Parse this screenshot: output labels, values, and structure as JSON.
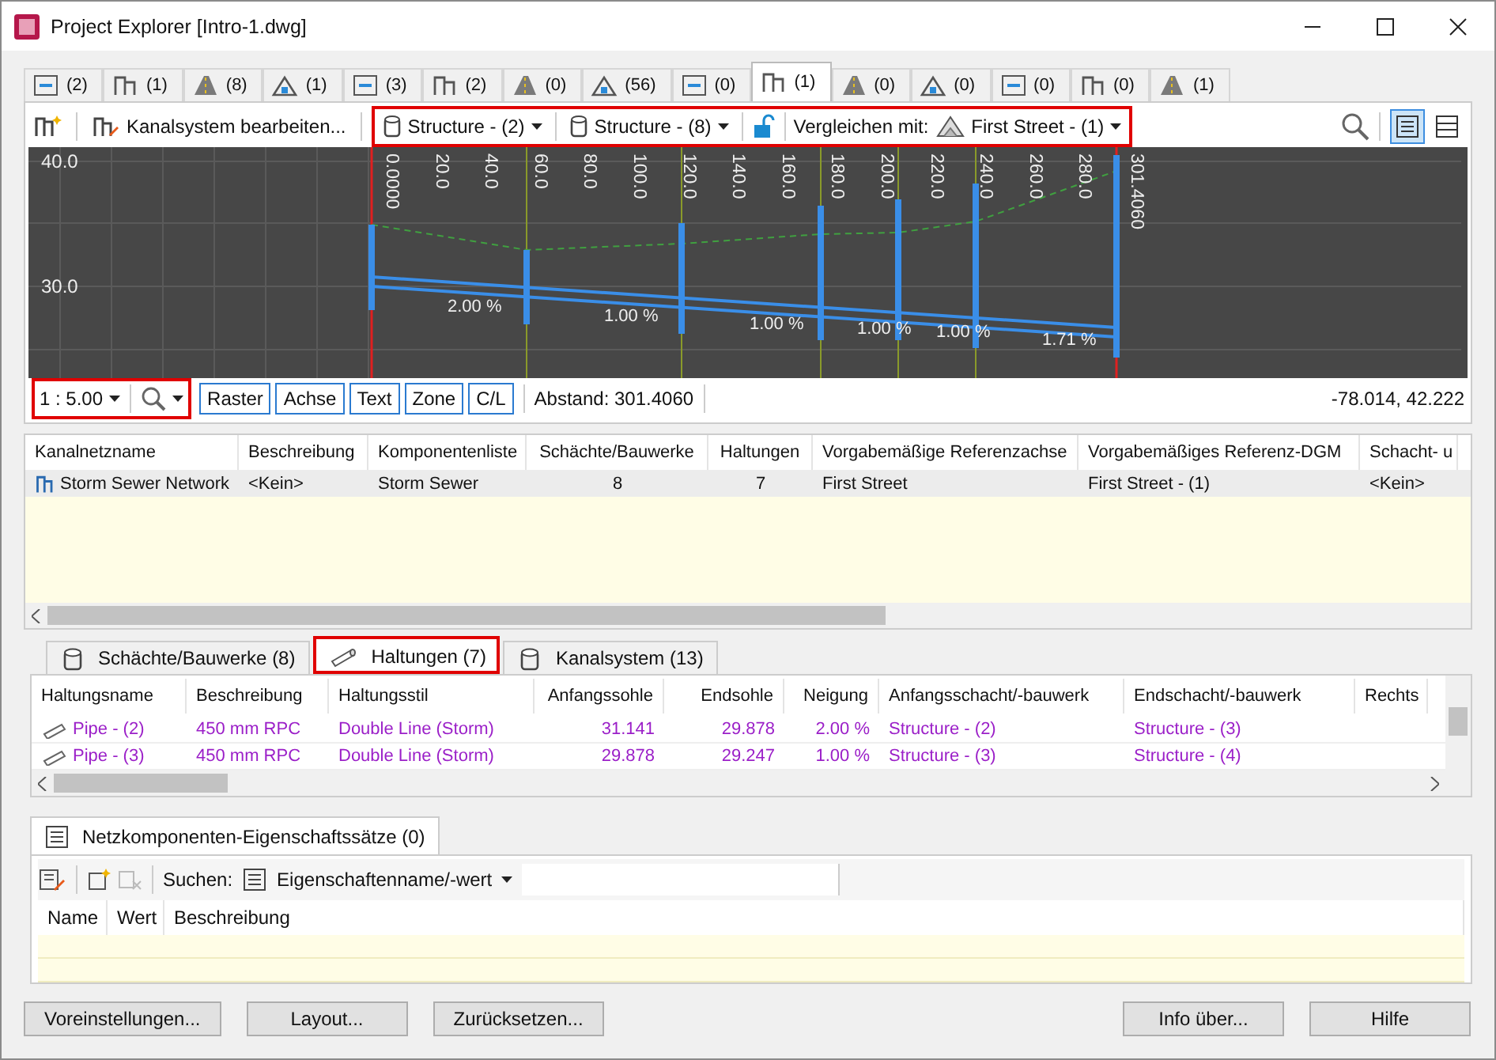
{
  "window": {
    "title": "Project Explorer [Intro-1.dwg]"
  },
  "object_tabs": [
    {
      "count": "(2)",
      "selected": false
    },
    {
      "count": "(1)",
      "selected": false
    },
    {
      "count": "(8)",
      "selected": false
    },
    {
      "count": "(1)",
      "selected": false
    },
    {
      "count": "(3)",
      "selected": false
    },
    {
      "count": "(2)",
      "selected": false
    },
    {
      "count": "(0)",
      "selected": false
    },
    {
      "count": "(56)",
      "selected": false
    },
    {
      "count": "(0)",
      "selected": false
    },
    {
      "count": "(1)",
      "selected": true
    },
    {
      "count": "(0)",
      "selected": false
    },
    {
      "count": "(0)",
      "selected": false
    },
    {
      "count": "(0)",
      "selected": false
    },
    {
      "count": "(0)",
      "selected": false
    },
    {
      "count": "(1)",
      "selected": false
    }
  ],
  "toolbar": {
    "edit_label": "Kanalsystem bearbeiten...",
    "highlighted": true,
    "start_structure": "Structure - (2)",
    "end_structure": "Structure - (8)",
    "compare_label": "Vergleichen mit:",
    "compare_surface": "First Street - (1)",
    "view_modes": [
      {
        "selected": true
      },
      {
        "selected": false
      }
    ]
  },
  "profile": {
    "y_labels": [
      "40.0",
      "30.0"
    ],
    "x_labels": [
      "0.0000",
      "20.0",
      "40.0",
      "60.0",
      "80.0",
      "100.0",
      "120.0",
      "140.0",
      "160.0",
      "180.0",
      "200.0",
      "220.0",
      "240.0",
      "260.0",
      "280.0",
      "301.4060"
    ],
    "slopes": [
      "2.00 %",
      "1.00 %",
      "1.00 %",
      "1.00 %",
      "1.00 %",
      "1.71 %"
    ]
  },
  "profile_status": {
    "scale": "1 : 5.00",
    "highlighted": true,
    "toggles": [
      "Raster",
      "Achse",
      "Text",
      "Zone",
      "C/L"
    ],
    "distance": "Abstand: 301.4060",
    "coordinates": "-78.014, 42.222"
  },
  "network_table": {
    "columns": [
      "Kanalnetzname",
      "Beschreibung",
      "Komponentenliste",
      "Schächte/Bauwerke",
      "Haltungen",
      "Vorgabemäßige Referenzachse",
      "Vorgabemäßiges Referenz-DGM",
      "Schacht- u"
    ],
    "rows": [
      [
        "Storm Sewer Network",
        "<Kein>",
        "Storm Sewer",
        "8",
        "7",
        "First Street",
        "First Street - (1)",
        "<Kein>"
      ]
    ]
  },
  "lower_tabs": [
    {
      "label": "Schächte/Bauwerke (8)",
      "selected": false,
      "highlighted": false
    },
    {
      "label": "Haltungen (7)",
      "selected": true,
      "highlighted": true
    },
    {
      "label": "Kanalsystem (13)",
      "selected": false,
      "highlighted": false
    }
  ],
  "pipes_table": {
    "columns": [
      "Haltungsname",
      "Beschreibung",
      "Haltungsstil",
      "Anfangssohle",
      "Endsohle",
      "Neigung",
      "Anfangsschacht/-bauwerk",
      "Endschacht/-bauwerk",
      "Rechts"
    ],
    "rows": [
      [
        "Pipe - (2)",
        "450 mm RPC",
        "Double Line (Storm)",
        "31.141",
        "29.878",
        "2.00 %",
        "Structure - (2)",
        "Structure - (3)"
      ],
      [
        "Pipe - (3)",
        "450 mm RPC",
        "Double Line (Storm)",
        "29.878",
        "29.247",
        "1.00 %",
        "Structure - (3)",
        "Structure - (4)"
      ]
    ]
  },
  "property_sets": {
    "tab": "Netzkomponenten-Eigenschaftssätze (0)",
    "search_label": "Suchen:",
    "search_mode": "Eigenschaftenname/-wert",
    "columns": [
      "Name",
      "Wert",
      "Beschreibung"
    ]
  },
  "buttons_left": [
    "Voreinstellungen...",
    "Layout...",
    "Zurücksetzen..."
  ],
  "buttons_right": [
    "Info über...",
    "Hilfe"
  ]
}
